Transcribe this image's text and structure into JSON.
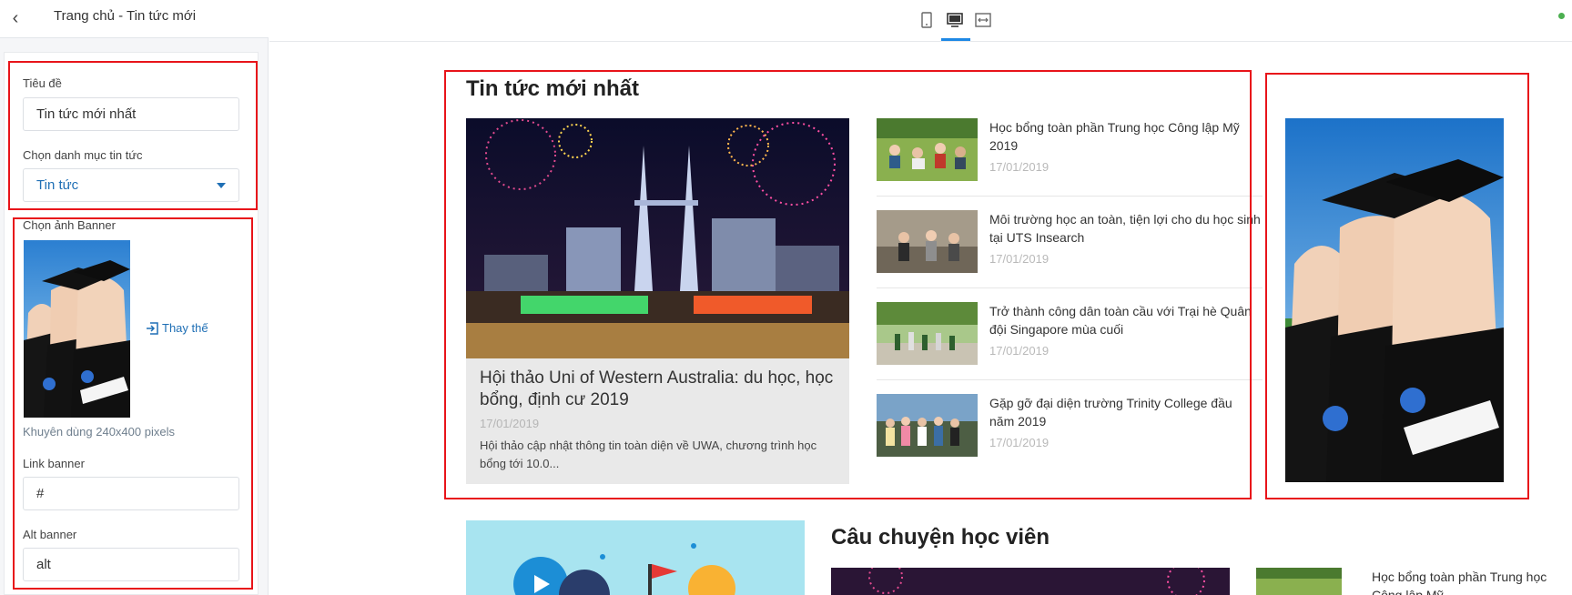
{
  "sidebar": {
    "title": "Trang chủ - Tin tức mới",
    "title_label": "Tiêu đề",
    "title_value": "Tin tức mới nhất",
    "category_label": "Chọn danh mục tin tức",
    "category_value": "Tin tức",
    "banner_label": "Chọn ảnh Banner",
    "replace_label": "Thay thế",
    "banner_hint": "Khuyên dùng 240x400 pixels",
    "link_label": "Link banner",
    "link_value": "#",
    "alt_label": "Alt banner",
    "alt_value": "alt"
  },
  "toolbar": {
    "icons": [
      "mobile-icon",
      "desktop-icon",
      "fullwidth-icon"
    ],
    "active": "desktop-icon"
  },
  "preview": {
    "section_title": "Tin tức mới nhất",
    "featured": {
      "title": "Hội thảo Uni of Western Australia: du học, học bổng, định cư 2019",
      "date": "17/01/2019",
      "desc": "Hội thảo cập nhật thông tin toàn diện về UWA, chương trình học bổng tới 10.0..."
    },
    "items": [
      {
        "title": "Học bổng toàn phần Trung học Công lập Mỹ 2019",
        "date": "17/01/2019"
      },
      {
        "title": "Môi trường học an toàn, tiện lợi cho du học sinh tại UTS Insearch",
        "date": "17/01/2019"
      },
      {
        "title": "Trở thành công dân toàn cầu với Trại hè Quân đội Singapore mùa cuối",
        "date": "17/01/2019"
      },
      {
        "title": "Gặp gỡ đại diện trường Trinity College đầu năm 2019",
        "date": "17/01/2019"
      }
    ],
    "section2_title": "Câu chuyện học viên",
    "section2_item": "Học bổng toàn phần Trung học Công lập Mỹ"
  },
  "colors": {
    "accent": "#1f6fb5",
    "highlight_border": "#e8141a",
    "active_tab": "#1e88e5",
    "status": "#4caf50"
  }
}
